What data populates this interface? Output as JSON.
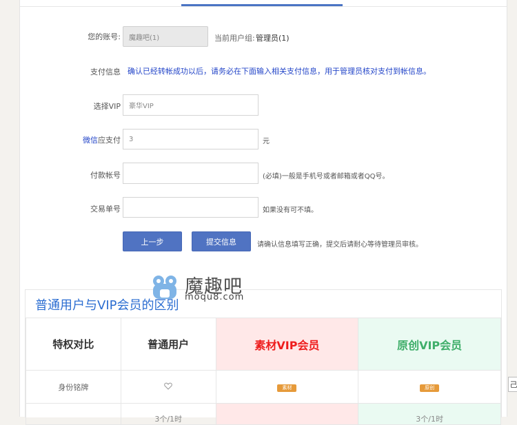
{
  "form": {
    "account_label": "您的账号:",
    "account_value": "魔趣吧(1)",
    "group_label": "当前用户组:",
    "group_value": "管理员(1)",
    "pay_info_label": "支付信息",
    "pay_info_notice": "确认已经转帐成功以后，请务必在下面输入相关支付信息，用于管理员核对支付到帐信息。",
    "vip_label": "选择VIP",
    "vip_value": "豪华VIP",
    "amount_method": "微信",
    "amount_label": "应支付",
    "amount_value": "3",
    "amount_unit": "元",
    "pay_account_label": "付款帐号",
    "pay_account_value": "",
    "pay_account_hint": "(必填)一般是手机号或者邮箱或者QQ号。",
    "trade_no_label": "交易单号",
    "trade_no_value": "",
    "trade_no_hint": "如果没有可不填。",
    "prev_button": "上一步",
    "submit_button": "提交信息",
    "submit_hint": "请确认信息填写正确，提交后请耐心等待管理员审核。"
  },
  "watermark": {
    "name": "魔趣吧",
    "domain": "moqu8.com"
  },
  "comparison": {
    "title": "普通用户与VIP会员的区别",
    "headers": [
      "特权对比",
      "普通用户",
      "素材VIP会员",
      "原创VIP会员"
    ],
    "rows": [
      {
        "label": "身份铭牌",
        "normal_icon": "heart-outline-icon",
        "vip1_badge": "素材",
        "vip2_badge": "原创"
      }
    ],
    "partial_row": {
      "normal": "3个/1时",
      "vip2": "3个/1时"
    }
  },
  "side_button": "己",
  "colors": {
    "accent": "#5073c2",
    "notice": "#2345c8",
    "title": "#2b6dd1",
    "vip1": "#ee1c1c",
    "vip2": "#3fae6a",
    "badge": "#e69a3a"
  }
}
